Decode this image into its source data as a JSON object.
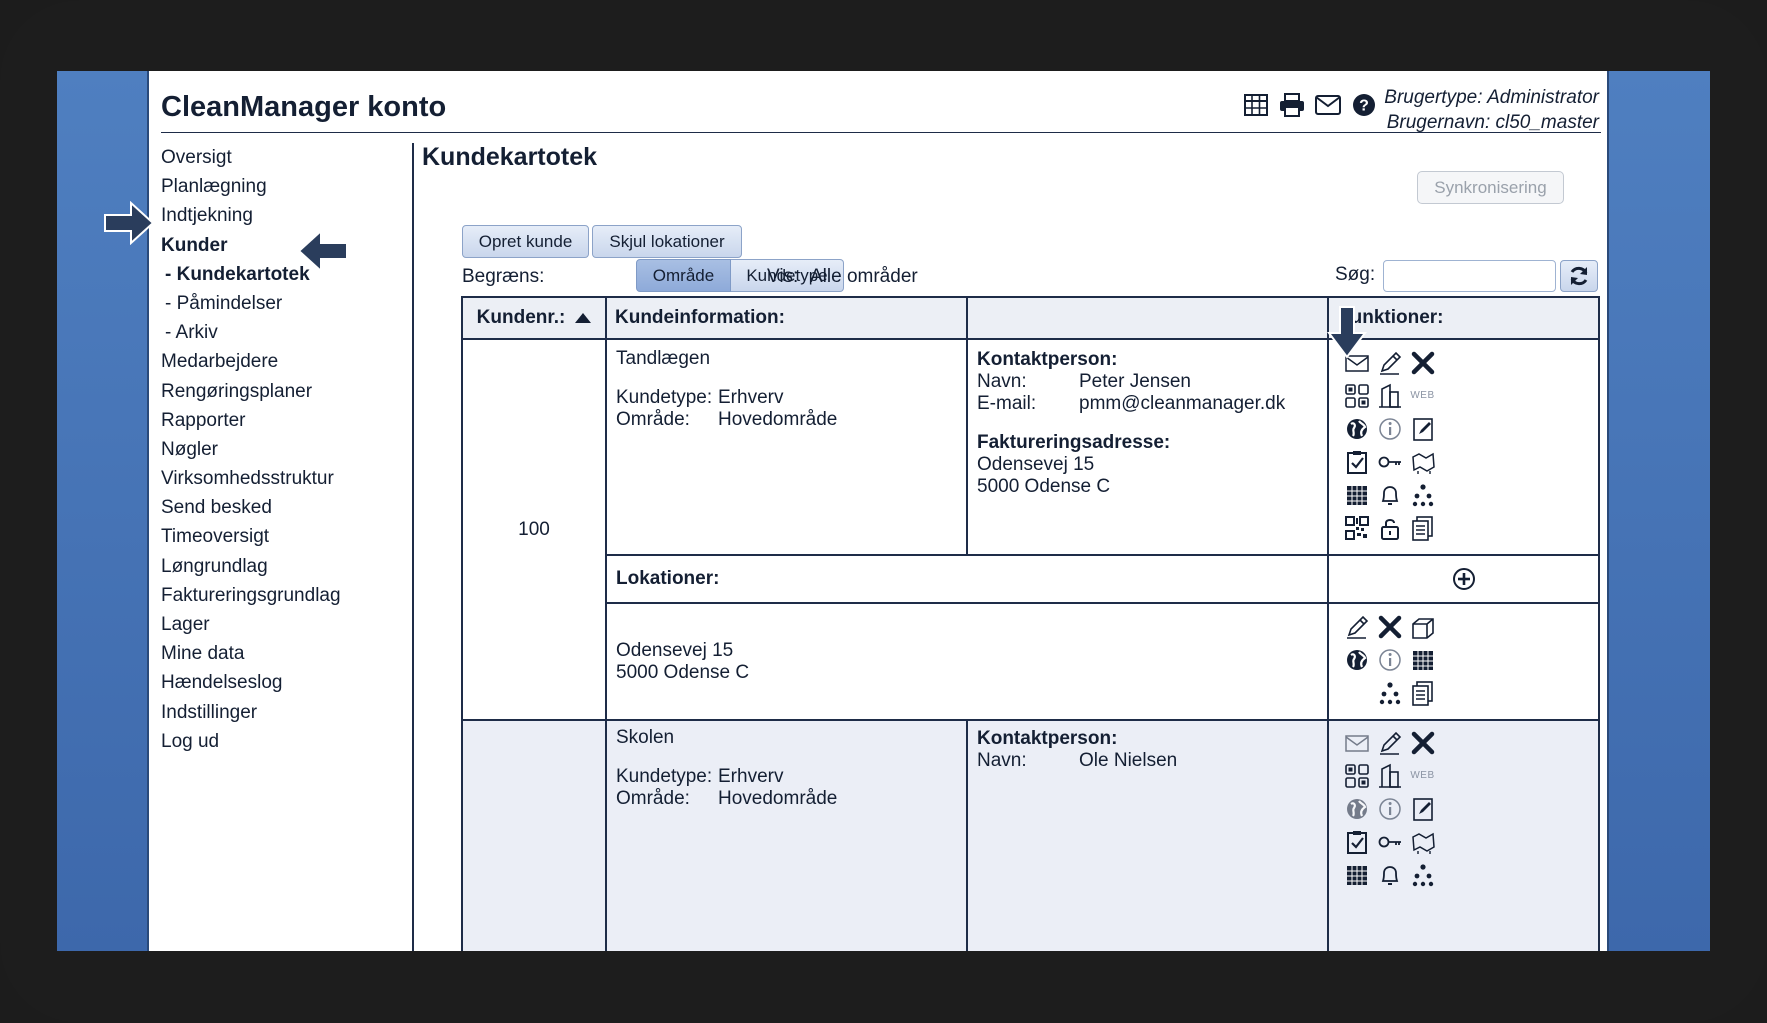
{
  "app": {
    "title": "CleanManager konto",
    "user_type": "Brugertype: Administrator",
    "user_name": "Brugernavn: cl50_master",
    "header_icons": [
      "table-icon",
      "print-icon",
      "mail-icon",
      "help-icon"
    ]
  },
  "sidebar": {
    "items": [
      {
        "label": "Oversigt",
        "bold": false,
        "sub": false
      },
      {
        "label": "Planlægning",
        "bold": false,
        "sub": false
      },
      {
        "label": "Indtjekning",
        "bold": false,
        "sub": false
      },
      {
        "label": "Kunder",
        "bold": true,
        "sub": false
      },
      {
        "label": "- Kundekartotek",
        "bold": true,
        "sub": true
      },
      {
        "label": "- Påmindelser",
        "bold": false,
        "sub": true
      },
      {
        "label": "- Arkiv",
        "bold": false,
        "sub": true
      },
      {
        "label": "Medarbejdere",
        "bold": false,
        "sub": false
      },
      {
        "label": "Rengøringsplaner",
        "bold": false,
        "sub": false
      },
      {
        "label": "Rapporter",
        "bold": false,
        "sub": false
      },
      {
        "label": "Nøgler",
        "bold": false,
        "sub": false
      },
      {
        "label": "Virksomhedsstruktur",
        "bold": false,
        "sub": false
      },
      {
        "label": "Send besked",
        "bold": false,
        "sub": false
      },
      {
        "label": "Timeoversigt",
        "bold": false,
        "sub": false
      },
      {
        "label": "Løngrundlag",
        "bold": false,
        "sub": false
      },
      {
        "label": "Faktureringsgrundlag",
        "bold": false,
        "sub": false
      },
      {
        "label": "Lager",
        "bold": false,
        "sub": false
      },
      {
        "label": "Mine data",
        "bold": false,
        "sub": false
      },
      {
        "label": "Hændelseslog",
        "bold": false,
        "sub": false
      },
      {
        "label": "Indstillinger",
        "bold": false,
        "sub": false
      },
      {
        "label": "Log ud",
        "bold": false,
        "sub": false
      }
    ]
  },
  "main": {
    "title": "Kundekartotek",
    "sync_label": "Synkronisering",
    "create_customer_label": "Opret kunde",
    "hide_locations_label": "Skjul lokationer",
    "filter_label": "Begræns:",
    "filter_area": "Område",
    "filter_type": "Kundetype",
    "vis_label": "Vis:",
    "vis_value": "Alle områder",
    "search_label": "Søg:",
    "search_value": ""
  },
  "table": {
    "col_number": "Kundenr.:",
    "col_info": "Kundeinformation:",
    "col_functions": "Funktioner:",
    "locations_label": "Lokationer:",
    "customers": [
      {
        "number": "100",
        "name": "Tandlægen",
        "type_label": "Kundetype:",
        "type_value": "Erhverv",
        "area_label": "Område:",
        "area_value": "Hovedområde",
        "contact_label": "Kontaktperson:",
        "contact_name_label": "Navn:",
        "contact_name": "Peter Jensen",
        "contact_email_label": "E-mail:",
        "contact_email": "pmm@cleanmanager.dk",
        "billing_label": "Faktureringsadresse:",
        "billing_line1": "Odensevej 15",
        "billing_line2": "5000 Odense C",
        "location_line1": "Odensevej 15",
        "location_line2": "5000 Odense C"
      },
      {
        "name": "Skolen",
        "type_label": "Kundetype:",
        "type_value": "Erhverv",
        "area_label": "Område:",
        "area_value": "Hovedområde",
        "contact_label": "Kontaktperson:",
        "contact_name_label": "Navn:",
        "contact_name": "Ole Nielsen"
      }
    ]
  },
  "colors": {
    "text": "#141f33",
    "border": "#1e2c48",
    "header_bg": "#eceff5",
    "row_alt_bg": "#ebeef6",
    "arrow": "#2a3d5c",
    "desktop": "#4a78b8"
  }
}
